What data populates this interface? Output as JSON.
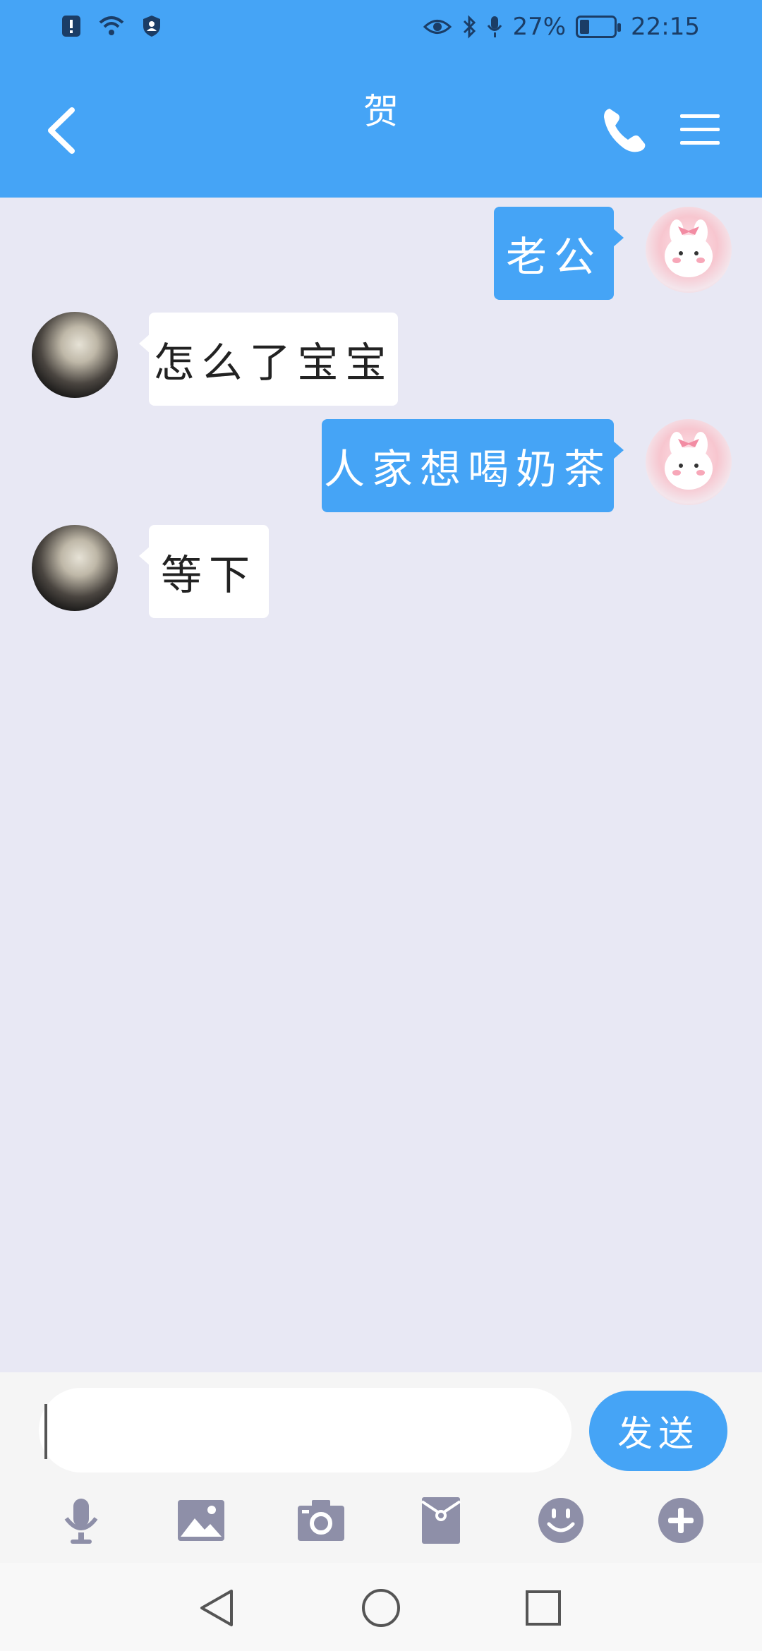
{
  "status_bar": {
    "battery_text": "27%",
    "time": "22:15",
    "icons": [
      "alert-icon",
      "wifi-icon",
      "security-icon",
      "eye-icon",
      "bluetooth-icon",
      "microphone-icon",
      "battery-icon"
    ],
    "battery_level": 0.27
  },
  "header": {
    "title": "贺",
    "back_icon": "chevron-left-icon",
    "call_icon": "phone-icon",
    "menu_icon": "menu-icon"
  },
  "messages": [
    {
      "from": "self",
      "text": "老公"
    },
    {
      "from": "other",
      "text": "怎么了宝宝"
    },
    {
      "from": "self",
      "text": "人家想喝奶茶"
    },
    {
      "from": "other",
      "text": "等下"
    }
  ],
  "composer": {
    "input_value": "",
    "send_label": "发送",
    "tools": [
      "voice-icon",
      "image-icon",
      "camera-icon",
      "red-packet-icon",
      "emoji-icon",
      "plus-icon"
    ]
  },
  "navbar": {
    "buttons": [
      "back-triangle-icon",
      "home-circle-icon",
      "recent-square-icon"
    ]
  },
  "colors": {
    "accent": "#45a4f6",
    "chat_background": "#e8e8f4",
    "bubble_in": "#ffffff",
    "tool_gray": "#8e8fa8"
  }
}
